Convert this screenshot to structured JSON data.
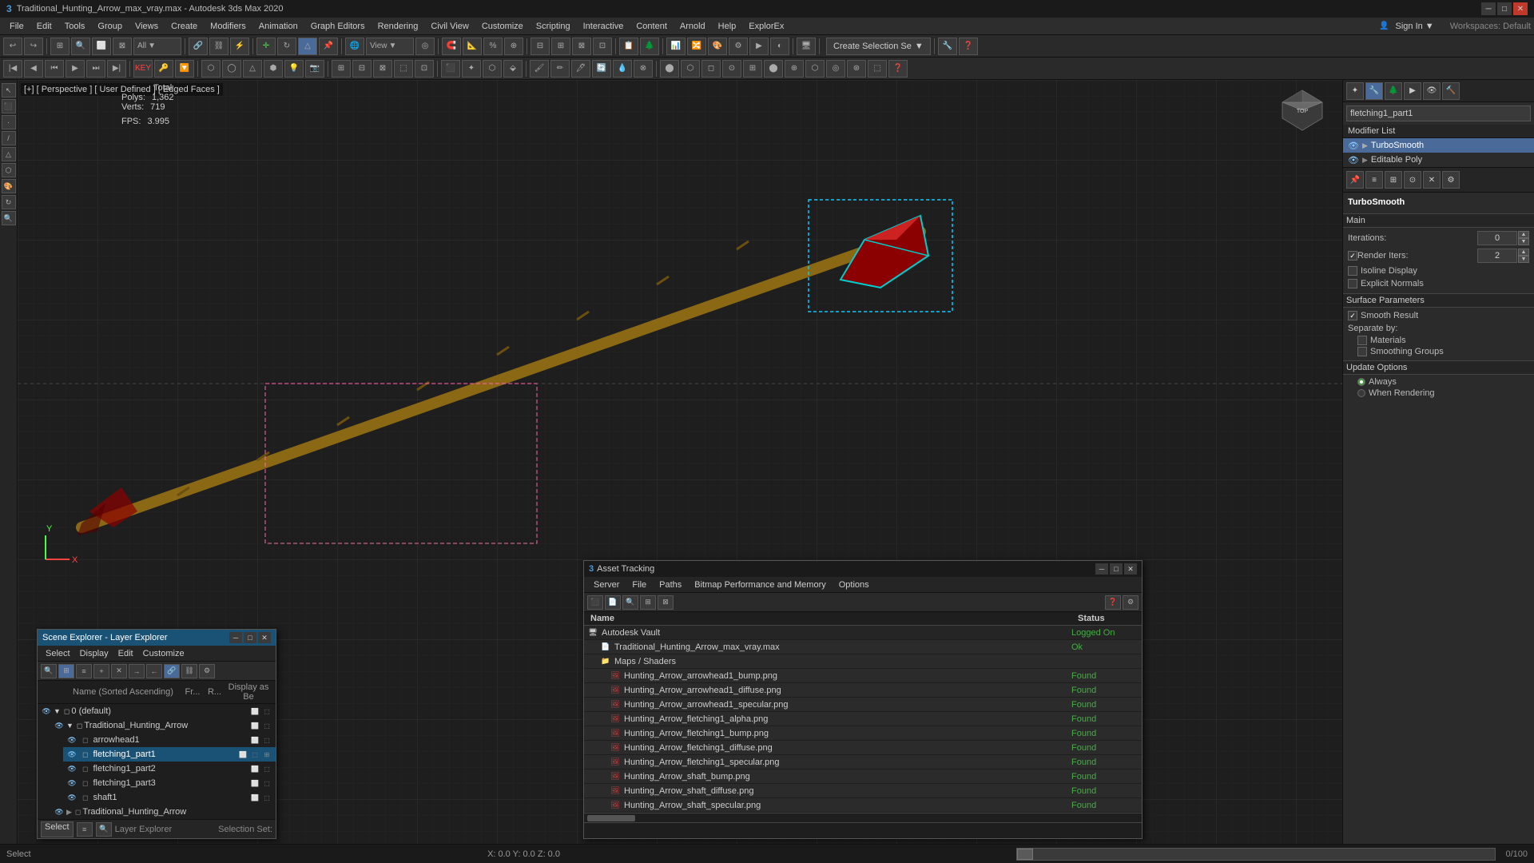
{
  "titlebar": {
    "title": "Traditional_Hunting_Arrow_max_vray.max - Autodesk 3ds Max 2020",
    "icon": "3dsmax-icon",
    "minimize": "─",
    "restore": "□",
    "close": "✕"
  },
  "menubar": {
    "items": [
      "File",
      "Edit",
      "Tools",
      "Group",
      "Views",
      "Create",
      "Modifiers",
      "Animation",
      "Graph Editors",
      "Rendering",
      "Civil View",
      "Customize",
      "Scripting",
      "Interactive",
      "Content",
      "Arnold",
      "Help",
      "ExplorEx"
    ]
  },
  "toolbar1": {
    "create_selection_label": "Create Selection Se",
    "view_label": "View",
    "all_label": "All"
  },
  "viewport": {
    "label": "[+] [ Perspective ] [ User Defined ] [ Edged Faces ]",
    "stats": {
      "polys_label": "Polys:",
      "polys_value": "1,362",
      "verts_label": "Verts:",
      "verts_value": "719",
      "fps_label": "FPS:",
      "fps_value": "3.995",
      "total_label": "Total"
    }
  },
  "right_panel": {
    "object_name": "fletching1_part1",
    "modifier_list_label": "Modifier List",
    "modifiers": [
      {
        "name": "TurboSmooth",
        "selected": true
      },
      {
        "name": "Editable Poly",
        "selected": false
      }
    ],
    "turbosmooth": {
      "section_main": "Main",
      "iterations_label": "Iterations:",
      "iterations_value": "0",
      "render_iters_label": "Render Iters:",
      "render_iters_value": "2",
      "isoline_display_label": "Isoline Display",
      "explicit_normals_label": "Explicit Normals",
      "surface_params_label": "Surface Parameters",
      "smooth_result_label": "Smooth Result",
      "separate_by_label": "Separate by:",
      "materials_label": "Materials",
      "smoothing_groups_label": "Smoothing Groups",
      "update_options_label": "Update Options",
      "always_label": "Always",
      "when_rendering_label": "When Rendering"
    }
  },
  "scene_explorer": {
    "title": "Scene Explorer - Layer Explorer",
    "menus": [
      "Select",
      "Display",
      "Edit",
      "Customize"
    ],
    "columns": [
      "Name (Sorted Ascending)",
      "Fr...",
      "R...",
      "Display as Be"
    ],
    "rows": [
      {
        "name": "0 (default)",
        "indent": 0,
        "expanded": true,
        "type": "layer"
      },
      {
        "name": "Traditional_Hunting_Arrow",
        "indent": 1,
        "expanded": true,
        "type": "object"
      },
      {
        "name": "arrowhead1",
        "indent": 2,
        "type": "object"
      },
      {
        "name": "fletching1_part1",
        "indent": 2,
        "type": "object",
        "selected": true
      },
      {
        "name": "fletching1_part2",
        "indent": 2,
        "type": "object"
      },
      {
        "name": "fletching1_part3",
        "indent": 2,
        "type": "object"
      },
      {
        "name": "shaft1",
        "indent": 2,
        "type": "object"
      },
      {
        "name": "Traditional_Hunting_Arrow",
        "indent": 1,
        "type": "object"
      }
    ],
    "footer": {
      "select_label": "Select",
      "layer_explorer_label": "Layer Explorer",
      "selection_set_label": "Selection Set:"
    }
  },
  "asset_tracking": {
    "title": "Asset Tracking",
    "menus": [
      "Server",
      "File",
      "Paths",
      "Bitmap Performance and Memory",
      "Options"
    ],
    "columns": {
      "name": "Name",
      "status": "Status"
    },
    "rows": [
      {
        "name": "Autodesk Vault",
        "indent": 0,
        "type": "server",
        "status": "Logged On"
      },
      {
        "name": "Traditional_Hunting_Arrow_max_vray.max",
        "indent": 1,
        "type": "file",
        "status": "Ok"
      },
      {
        "name": "Maps / Shaders",
        "indent": 1,
        "type": "folder",
        "status": ""
      },
      {
        "name": "Hunting_Arrow_arrowhead1_bump.png",
        "indent": 2,
        "type": "image",
        "status": "Found"
      },
      {
        "name": "Hunting_Arrow_arrowhead1_diffuse.png",
        "indent": 2,
        "type": "image",
        "status": "Found"
      },
      {
        "name": "Hunting_Arrow_arrowhead1_specular.png",
        "indent": 2,
        "type": "image",
        "status": "Found"
      },
      {
        "name": "Hunting_Arrow_fletching1_alpha.png",
        "indent": 2,
        "type": "image",
        "status": "Found"
      },
      {
        "name": "Hunting_Arrow_fletching1_bump.png",
        "indent": 2,
        "type": "image",
        "status": "Found"
      },
      {
        "name": "Hunting_Arrow_fletching1_diffuse.png",
        "indent": 2,
        "type": "image",
        "status": "Found"
      },
      {
        "name": "Hunting_Arrow_fletching1_specular.png",
        "indent": 2,
        "type": "image",
        "status": "Found"
      },
      {
        "name": "Hunting_Arrow_shaft_bump.png",
        "indent": 2,
        "type": "image",
        "status": "Found"
      },
      {
        "name": "Hunting_Arrow_shaft_diffuse.png",
        "indent": 2,
        "type": "image",
        "status": "Found"
      },
      {
        "name": "Hunting_Arrow_shaft_specular.png",
        "indent": 2,
        "type": "image",
        "status": "Found"
      }
    ]
  },
  "statusbar": {
    "select_label": "Select",
    "coords": "X: 0.0  Y: 0.0  Z: 0.0"
  },
  "icons": {
    "eye": "👁",
    "cube": "⬛",
    "chevron_right": "▶",
    "chevron_down": "▼",
    "lock": "🔒",
    "image": "🖼",
    "file": "📄",
    "folder": "📁",
    "server": "🖥",
    "arrow_up": "▲",
    "arrow_down": "▼",
    "check": "✓"
  }
}
